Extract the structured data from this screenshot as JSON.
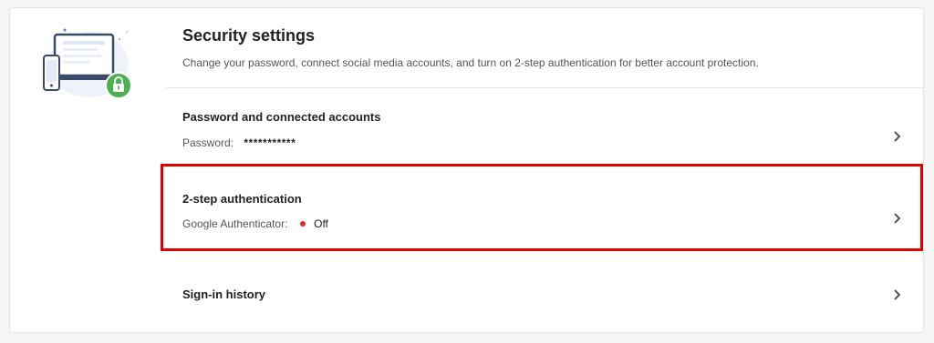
{
  "header": {
    "title": "Security settings",
    "description": "Change your password, connect social media accounts, and turn on 2-step authentication for better account protection."
  },
  "rows": [
    {
      "title": "Password and connected accounts",
      "sub_label": "Password:",
      "sub_value": "***********"
    },
    {
      "title": "2-step authentication",
      "sub_label": "Google Authenticator:",
      "sub_value": "Off",
      "status_color": "#d93025"
    },
    {
      "title": "Sign-in history"
    }
  ],
  "icons": {
    "illustration": "devices-lock-icon",
    "chevron": "chevron-right-icon"
  },
  "colors": {
    "highlight": "#e00000",
    "lock_green": "#4caf50"
  }
}
